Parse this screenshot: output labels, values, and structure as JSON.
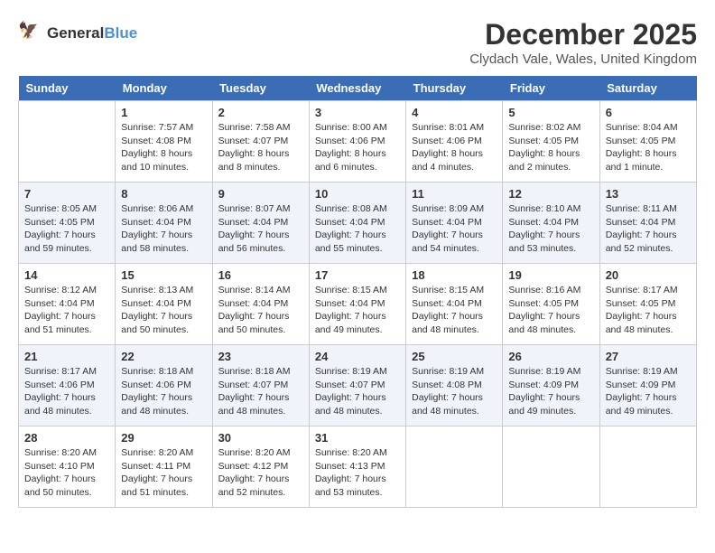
{
  "header": {
    "logo_general": "General",
    "logo_blue": "Blue",
    "month_title": "December 2025",
    "location": "Clydach Vale, Wales, United Kingdom"
  },
  "days_of_week": [
    "Sunday",
    "Monday",
    "Tuesday",
    "Wednesday",
    "Thursday",
    "Friday",
    "Saturday"
  ],
  "weeks": [
    [
      {
        "date": "",
        "sunrise": "",
        "sunset": "",
        "daylight": ""
      },
      {
        "date": "1",
        "sunrise": "Sunrise: 7:57 AM",
        "sunset": "Sunset: 4:08 PM",
        "daylight": "Daylight: 8 hours and 10 minutes."
      },
      {
        "date": "2",
        "sunrise": "Sunrise: 7:58 AM",
        "sunset": "Sunset: 4:07 PM",
        "daylight": "Daylight: 8 hours and 8 minutes."
      },
      {
        "date": "3",
        "sunrise": "Sunrise: 8:00 AM",
        "sunset": "Sunset: 4:06 PM",
        "daylight": "Daylight: 8 hours and 6 minutes."
      },
      {
        "date": "4",
        "sunrise": "Sunrise: 8:01 AM",
        "sunset": "Sunset: 4:06 PM",
        "daylight": "Daylight: 8 hours and 4 minutes."
      },
      {
        "date": "5",
        "sunrise": "Sunrise: 8:02 AM",
        "sunset": "Sunset: 4:05 PM",
        "daylight": "Daylight: 8 hours and 2 minutes."
      },
      {
        "date": "6",
        "sunrise": "Sunrise: 8:04 AM",
        "sunset": "Sunset: 4:05 PM",
        "daylight": "Daylight: 8 hours and 1 minute."
      }
    ],
    [
      {
        "date": "7",
        "sunrise": "Sunrise: 8:05 AM",
        "sunset": "Sunset: 4:05 PM",
        "daylight": "Daylight: 7 hours and 59 minutes."
      },
      {
        "date": "8",
        "sunrise": "Sunrise: 8:06 AM",
        "sunset": "Sunset: 4:04 PM",
        "daylight": "Daylight: 7 hours and 58 minutes."
      },
      {
        "date": "9",
        "sunrise": "Sunrise: 8:07 AM",
        "sunset": "Sunset: 4:04 PM",
        "daylight": "Daylight: 7 hours and 56 minutes."
      },
      {
        "date": "10",
        "sunrise": "Sunrise: 8:08 AM",
        "sunset": "Sunset: 4:04 PM",
        "daylight": "Daylight: 7 hours and 55 minutes."
      },
      {
        "date": "11",
        "sunrise": "Sunrise: 8:09 AM",
        "sunset": "Sunset: 4:04 PM",
        "daylight": "Daylight: 7 hours and 54 minutes."
      },
      {
        "date": "12",
        "sunrise": "Sunrise: 8:10 AM",
        "sunset": "Sunset: 4:04 PM",
        "daylight": "Daylight: 7 hours and 53 minutes."
      },
      {
        "date": "13",
        "sunrise": "Sunrise: 8:11 AM",
        "sunset": "Sunset: 4:04 PM",
        "daylight": "Daylight: 7 hours and 52 minutes."
      }
    ],
    [
      {
        "date": "14",
        "sunrise": "Sunrise: 8:12 AM",
        "sunset": "Sunset: 4:04 PM",
        "daylight": "Daylight: 7 hours and 51 minutes."
      },
      {
        "date": "15",
        "sunrise": "Sunrise: 8:13 AM",
        "sunset": "Sunset: 4:04 PM",
        "daylight": "Daylight: 7 hours and 50 minutes."
      },
      {
        "date": "16",
        "sunrise": "Sunrise: 8:14 AM",
        "sunset": "Sunset: 4:04 PM",
        "daylight": "Daylight: 7 hours and 50 minutes."
      },
      {
        "date": "17",
        "sunrise": "Sunrise: 8:15 AM",
        "sunset": "Sunset: 4:04 PM",
        "daylight": "Daylight: 7 hours and 49 minutes."
      },
      {
        "date": "18",
        "sunrise": "Sunrise: 8:15 AM",
        "sunset": "Sunset: 4:04 PM",
        "daylight": "Daylight: 7 hours and 48 minutes."
      },
      {
        "date": "19",
        "sunrise": "Sunrise: 8:16 AM",
        "sunset": "Sunset: 4:05 PM",
        "daylight": "Daylight: 7 hours and 48 minutes."
      },
      {
        "date": "20",
        "sunrise": "Sunrise: 8:17 AM",
        "sunset": "Sunset: 4:05 PM",
        "daylight": "Daylight: 7 hours and 48 minutes."
      }
    ],
    [
      {
        "date": "21",
        "sunrise": "Sunrise: 8:17 AM",
        "sunset": "Sunset: 4:06 PM",
        "daylight": "Daylight: 7 hours and 48 minutes."
      },
      {
        "date": "22",
        "sunrise": "Sunrise: 8:18 AM",
        "sunset": "Sunset: 4:06 PM",
        "daylight": "Daylight: 7 hours and 48 minutes."
      },
      {
        "date": "23",
        "sunrise": "Sunrise: 8:18 AM",
        "sunset": "Sunset: 4:07 PM",
        "daylight": "Daylight: 7 hours and 48 minutes."
      },
      {
        "date": "24",
        "sunrise": "Sunrise: 8:19 AM",
        "sunset": "Sunset: 4:07 PM",
        "daylight": "Daylight: 7 hours and 48 minutes."
      },
      {
        "date": "25",
        "sunrise": "Sunrise: 8:19 AM",
        "sunset": "Sunset: 4:08 PM",
        "daylight": "Daylight: 7 hours and 48 minutes."
      },
      {
        "date": "26",
        "sunrise": "Sunrise: 8:19 AM",
        "sunset": "Sunset: 4:09 PM",
        "daylight": "Daylight: 7 hours and 49 minutes."
      },
      {
        "date": "27",
        "sunrise": "Sunrise: 8:19 AM",
        "sunset": "Sunset: 4:09 PM",
        "daylight": "Daylight: 7 hours and 49 minutes."
      }
    ],
    [
      {
        "date": "28",
        "sunrise": "Sunrise: 8:20 AM",
        "sunset": "Sunset: 4:10 PM",
        "daylight": "Daylight: 7 hours and 50 minutes."
      },
      {
        "date": "29",
        "sunrise": "Sunrise: 8:20 AM",
        "sunset": "Sunset: 4:11 PM",
        "daylight": "Daylight: 7 hours and 51 minutes."
      },
      {
        "date": "30",
        "sunrise": "Sunrise: 8:20 AM",
        "sunset": "Sunset: 4:12 PM",
        "daylight": "Daylight: 7 hours and 52 minutes."
      },
      {
        "date": "31",
        "sunrise": "Sunrise: 8:20 AM",
        "sunset": "Sunset: 4:13 PM",
        "daylight": "Daylight: 7 hours and 53 minutes."
      },
      {
        "date": "",
        "sunrise": "",
        "sunset": "",
        "daylight": ""
      },
      {
        "date": "",
        "sunrise": "",
        "sunset": "",
        "daylight": ""
      },
      {
        "date": "",
        "sunrise": "",
        "sunset": "",
        "daylight": ""
      }
    ]
  ]
}
